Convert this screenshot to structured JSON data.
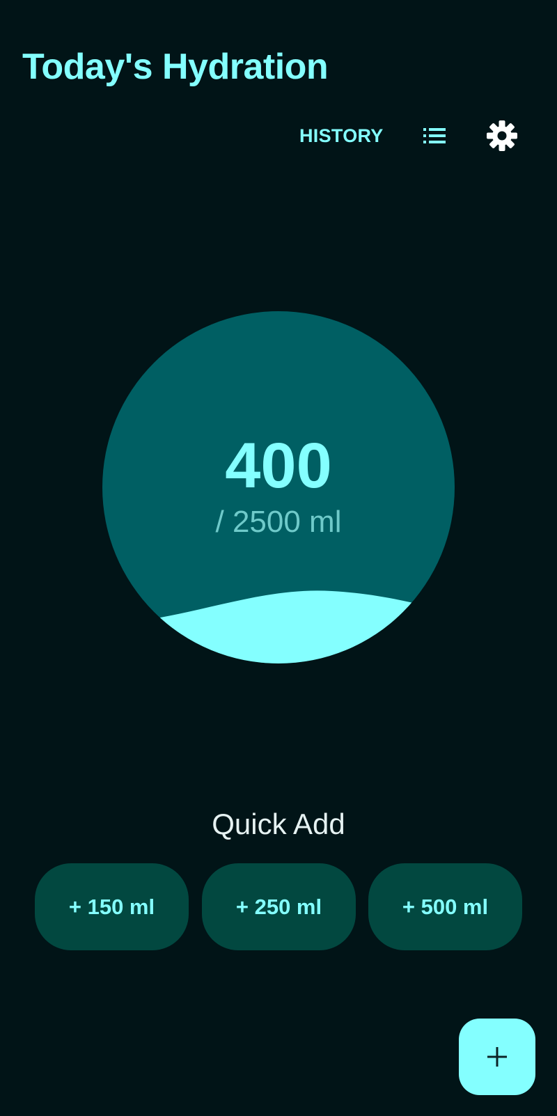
{
  "header": {
    "title": "Today's Hydration"
  },
  "toolbar": {
    "history_label": "HISTORY",
    "list_icon": "list-icon",
    "settings_icon": "gear-icon"
  },
  "progress": {
    "current": "400",
    "goal_text": "/ 2500 ml",
    "fill_fraction": 0.16
  },
  "quick_add": {
    "title": "Quick Add",
    "buttons": [
      {
        "label": "+ 150 ml"
      },
      {
        "label": "+ 250 ml"
      },
      {
        "label": "+ 500 ml"
      }
    ]
  },
  "fab": {
    "icon": "plus-icon"
  },
  "colors": {
    "background": "#011417",
    "accent": "#84FFFF",
    "circle": "#005F63",
    "button_bg": "#024840",
    "goal_text": "#6FCACA",
    "quick_add_title": "#E6F2F2"
  }
}
